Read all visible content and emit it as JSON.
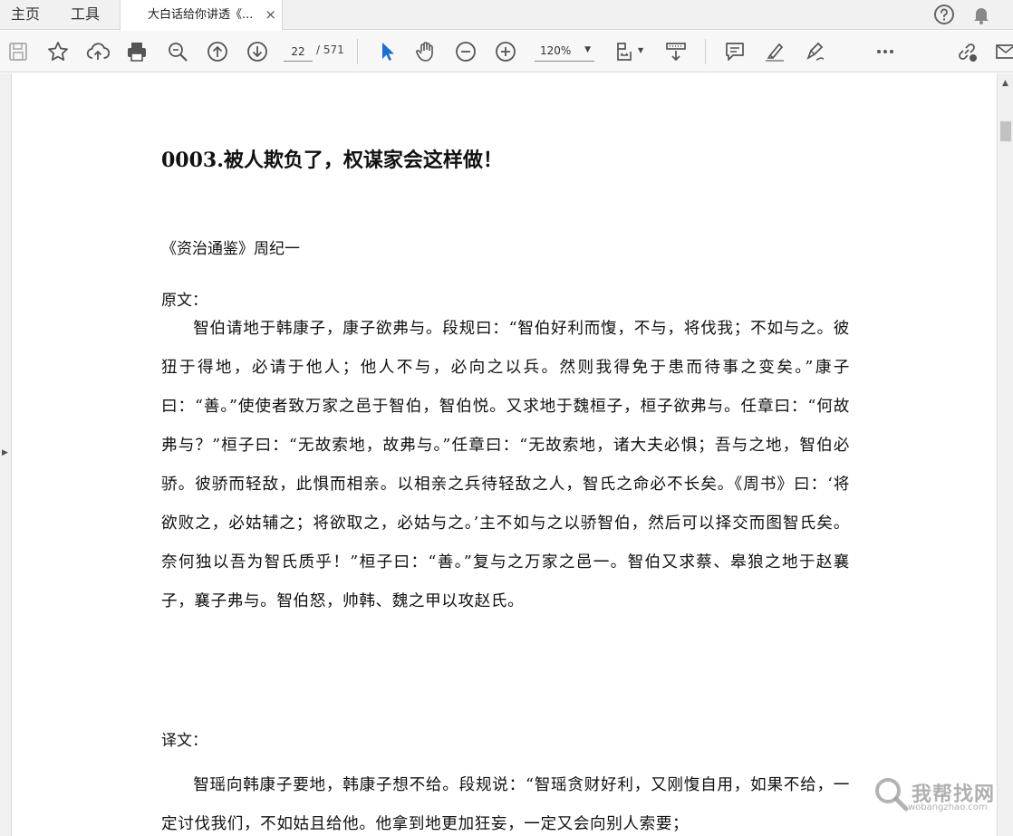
{
  "tabs": {
    "home": "主页",
    "tools": "工具",
    "document": "大白话给你讲透《...",
    "close": "×"
  },
  "toolbar": {
    "page_current": "22",
    "page_total": "/ 571",
    "zoom": "120%"
  },
  "icons": {
    "save": "save-icon",
    "bookmark": "star-icon",
    "upload": "cloud-upload-icon",
    "print": "print-icon",
    "zoom_search": "magnifier-icon",
    "prev_page": "arrow-up-circle-icon",
    "next_page": "arrow-down-circle-icon",
    "select": "cursor-icon",
    "pan": "hand-icon",
    "zoom_out": "minus-circle-icon",
    "zoom_in": "plus-circle-icon",
    "fit_page": "fit-page-icon",
    "scroll_mode": "scroll-mode-icon",
    "comment": "comment-icon",
    "highlight": "highlighter-icon",
    "sign": "sign-icon",
    "more": "more-icon",
    "share": "share-link-icon",
    "mail": "mail-icon",
    "help": "help-icon",
    "notifications": "bell-icon"
  },
  "colors": {
    "select_tool_active": "#1a6fd0",
    "toolbar_icon": "#555555"
  },
  "document": {
    "title": "0003.被人欺负了，权谋家会这样做！",
    "source": "《资治通鉴》周纪一",
    "original_label": "原文：",
    "original_text": "智伯请地于韩康子，康子欲弗与。段规曰：“智伯好利而愎，不与，将伐我；不如与之。彼狃于得地，必请于他人；他人不与，必向之以兵。然则我得免于患而待事之变矣。”康子曰：“善。”使使者致万家之邑于智伯，智伯悦。又求地于魏桓子，桓子欲弗与。任章曰：“何故弗与？”桓子曰：“无故索地，故弗与。”任章曰：“无故索地，诸大夫必惧；吾与之地，智伯必骄。彼骄而轻敌，此惧而相亲。以相亲之兵待轻敌之人，智氏之命必不长矣。《周书》曰：‘将欲败之，必姑辅之；将欲取之，必姑与之。’主不如与之以骄智伯，然后可以择交而图智氏矣。奈何独以吾为智氏质乎！”桓子曰：“善。”复与之万家之邑一。智伯又求蔡、皋狼之地于赵襄子，襄子弗与。智伯怒，帅韩、魏之甲以攻赵氏。",
    "translation_label": "译文：",
    "translation_text": "智瑶向韩康子要地，韩康子想不给。段规说：“智瑶贪财好利，又刚愎自用，如果不给，一定讨伐我们，不如姑且给他。他拿到地更加狂妄，一定又会向别人索要；"
  },
  "watermark": {
    "text": "我帮找网",
    "url": "wobangzhao.com"
  }
}
